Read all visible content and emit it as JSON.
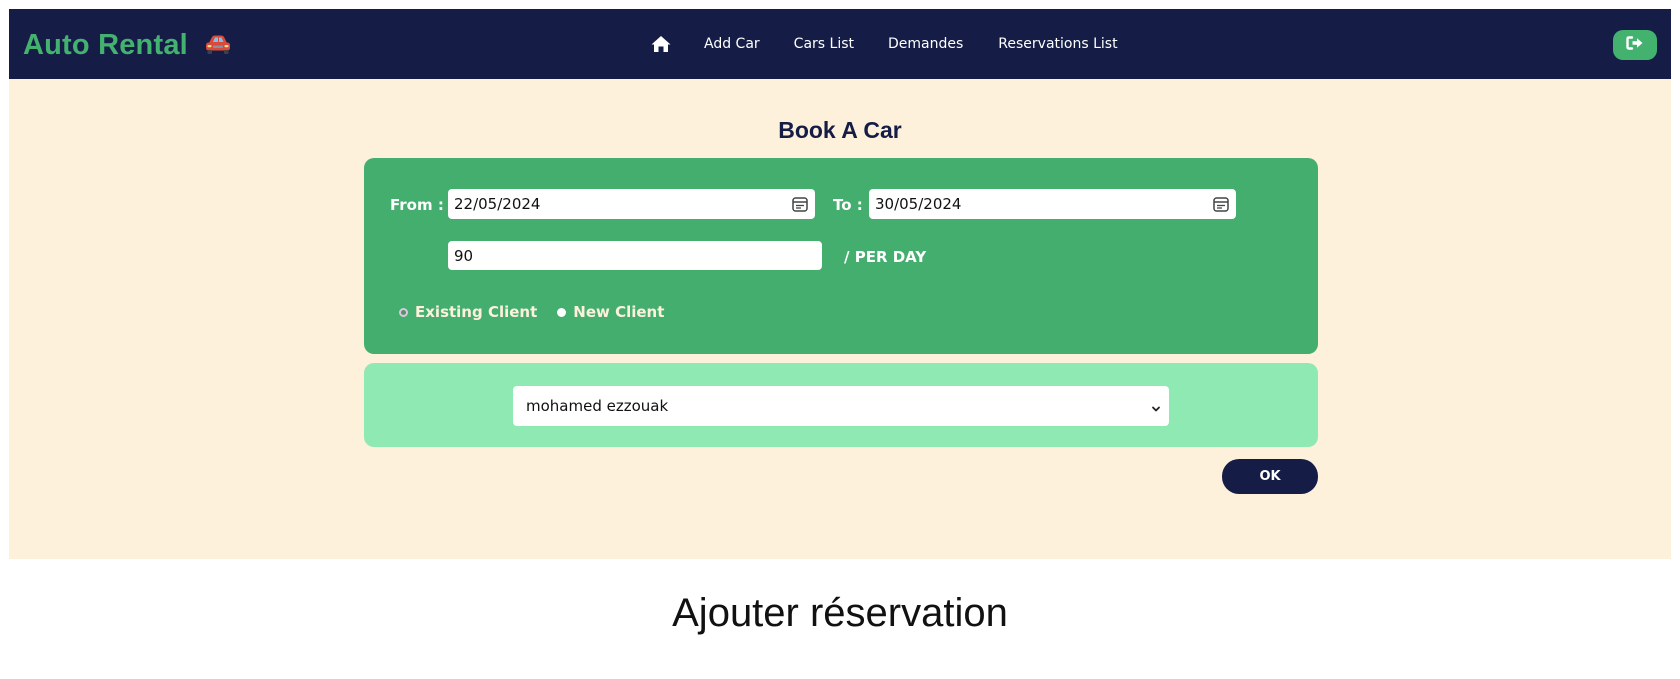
{
  "navbar": {
    "brand": "Auto Rental",
    "links": {
      "add_car": "Add Car",
      "cars_list": "Cars List",
      "demandes": "Demandes",
      "reservations_list": "Reservations List"
    }
  },
  "page": {
    "title": "Book A Car"
  },
  "form": {
    "from_label": "From :",
    "from_value": "22/05/2024",
    "to_label": "To :",
    "to_value": "30/05/2024",
    "price_value": "90",
    "price_suffix": "/ PER DAY",
    "client_options": {
      "existing": "Existing Client",
      "new": "New Client",
      "selected": "existing"
    },
    "client_select_value": "mohamed ezzouak",
    "ok_label": "OK"
  },
  "caption": "Ajouter réservation",
  "colors": {
    "navbar_bg": "#151d47",
    "brand_green": "#44b26f",
    "page_bg": "#fdf1dc",
    "form_card": "#44ae6f",
    "client_card": "#8fe9b3",
    "ok_button": "#151d47"
  },
  "icons": {
    "brand": "car-icon",
    "home": "home-icon",
    "logout": "logout-icon",
    "date": "calendar-icon",
    "select": "chevron-down-icon"
  }
}
